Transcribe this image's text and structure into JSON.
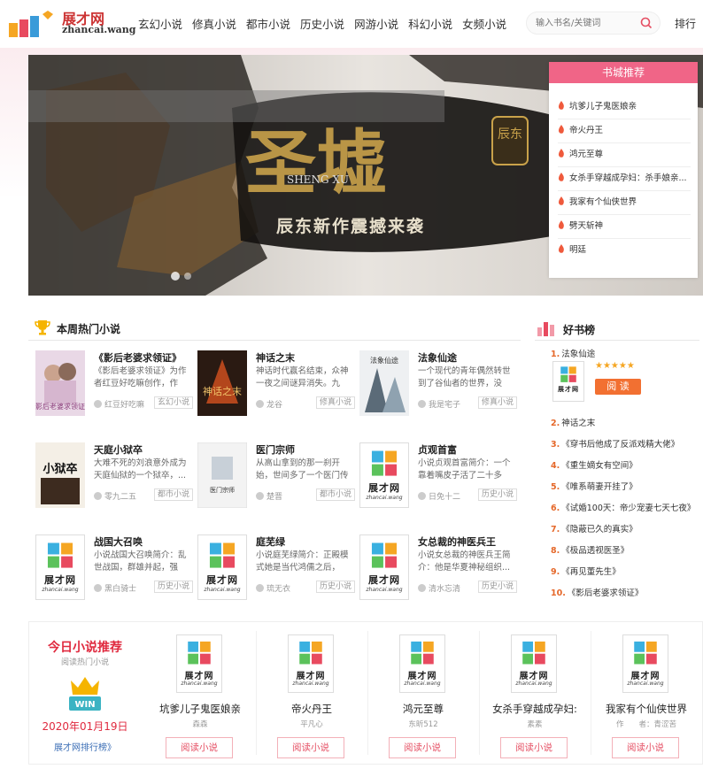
{
  "header": {
    "logo_cn": "展才网",
    "logo_en": "zhancai.wang",
    "nav": [
      "玄幻小说",
      "修真小说",
      "都市小说",
      "历史小说",
      "网游小说",
      "科幻小说",
      "女频小说"
    ],
    "search_placeholder": "输入书名/关键词",
    "rank_link": "排行"
  },
  "banner": {
    "title_glyphs": "圣墟",
    "pinyin": "SHENG XU",
    "seal": "辰东",
    "slogan": "辰东新作震撼来袭"
  },
  "recommend": {
    "title": "书城推荐",
    "items": [
      "坑爹儿子鬼医娘亲",
      "帝火丹王",
      "鸿元至尊",
      "女杀手穿越成孕妇：杀手娘亲...",
      "我家有个仙侠世界",
      "劈天斩神",
      "明廷"
    ]
  },
  "hot": {
    "title": "本周热门小说",
    "books": [
      {
        "title": "《影后老婆求领证》",
        "desc": "《影后老婆求领证》为作者红豆好吃嘛创作，作品...",
        "author": "红豆好吃嘛",
        "tag": "玄幻小说",
        "cover_text": "影后老婆求领证"
      },
      {
        "title": "神话之末",
        "desc": "神话时代赢名结束，众神一夜之间谜异消失。九州...",
        "author": "龙谷",
        "tag": "修真小说",
        "cover_text": "神话之末"
      },
      {
        "title": "法象仙途",
        "desc": "一个现代的青年偶然转世到了谷仙者的世界，没有...",
        "author": "我是宅子",
        "tag": "修真小说",
        "cover_text": "法象仙途"
      },
      {
        "title": "天庭小狱卒",
        "desc": "大难不死的刘浪意外成为天庭仙狱的一个狱卒，...",
        "author": "零九二五",
        "tag": "都市小说",
        "cover_text": "小狱卒"
      },
      {
        "title": "医门宗师",
        "desc": "从高山拿到的那一刹开始，世间多了一个医门传人...",
        "author": "楚晋",
        "tag": "都市小说",
        "cover_text": "医门宗师"
      },
      {
        "title": "贞观首富",
        "desc": "小说贞观首富简介：一个靠着嘴皮子活了二十多年...",
        "author": "日免十二",
        "tag": "历史小说",
        "cover_text": "展才网"
      },
      {
        "title": "战国大召唤",
        "desc": "小说战国大召唤简介：乱世战国，群雄并起，强豪...",
        "author": "黑白骑士",
        "tag": "历史小说",
        "cover_text": "展才网"
      },
      {
        "title": "庭芜绿",
        "desc": "小说庭芜绿简介：正殿模式她是当代鸿儒之后，却...",
        "author": "琉无衣",
        "tag": "历史小说",
        "cover_text": "展才网"
      },
      {
        "title": "女总裁的神医兵王",
        "desc": "小说女总裁的神医兵王简介：他是华夏神秘组织...",
        "author": "清水忘清",
        "tag": "历史小说",
        "cover_text": "展才网"
      }
    ]
  },
  "ranking": {
    "title": "好书榜",
    "top": {
      "rank": "1.",
      "title": "法象仙途",
      "stars": "★★★★★",
      "read": "阅 读"
    },
    "items": [
      {
        "rank": "2.",
        "title": "神话之末"
      },
      {
        "rank": "3.",
        "title": "《穿书后他成了反派戏精大佬》"
      },
      {
        "rank": "4.",
        "title": "《重生嫡女有空间》"
      },
      {
        "rank": "5.",
        "title": "《唯系萌妻开挂了》"
      },
      {
        "rank": "6.",
        "title": "《试婚100天：帝少宠妻七天七夜》"
      },
      {
        "rank": "7.",
        "title": "《隐蔽已久的真实》"
      },
      {
        "rank": "8.",
        "title": "《极品透视医圣》"
      },
      {
        "rank": "9.",
        "title": "《再见董先生》"
      },
      {
        "rank": "10.",
        "title": "《影后老婆求领证》"
      }
    ]
  },
  "today": {
    "title": "今日小说推荐",
    "subtitle": "阅读热门小说",
    "badge": "WIN",
    "date": "2020年01月19日",
    "link": "展才网排行榜》",
    "cards": [
      {
        "title": "坑爹儿子鬼医娘亲",
        "author": "森森",
        "btn": "阅读小说"
      },
      {
        "title": "帝火丹王",
        "author": "平凡心",
        "btn": "阅读小说"
      },
      {
        "title": "鸿元至尊",
        "author": "东昕512",
        "btn": "阅读小说"
      },
      {
        "title": "女杀手穿越成孕妇:",
        "author": "素素",
        "btn": "阅读小说"
      },
      {
        "title": "我家有个仙侠世界",
        "author": "作　　者：青涩苦",
        "btn": "阅读小说"
      }
    ]
  },
  "colors": {
    "accent": "#f06587",
    "red": "#e02a3f",
    "orange": "#f27031"
  }
}
